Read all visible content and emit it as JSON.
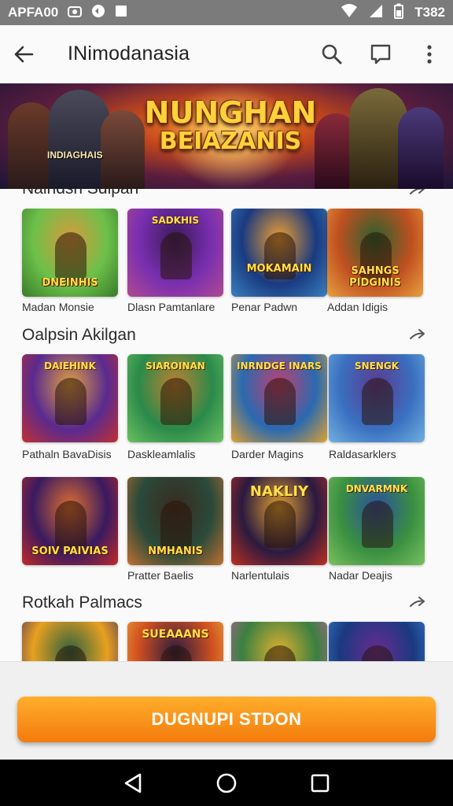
{
  "status_bar": {
    "left_text": "APFA00",
    "time": "T382"
  },
  "app_bar": {
    "title": "INimodanasia"
  },
  "hero": {
    "title_line1": "NUNGHAN",
    "title_line2": "BEIAZANIS",
    "subtitle": "INDIAGHAIS"
  },
  "sections": [
    {
      "title": "Nalndsn Sdipan",
      "items": [
        {
          "caption": "Madan Monsie",
          "art": "DNEINHIS",
          "colors": [
            "#6cc04a",
            "#3a7a2a",
            "#d89a3c"
          ]
        },
        {
          "caption": "Dlasn Pamtanlare",
          "art": "SADKHIS",
          "colors": [
            "#7a2fb0",
            "#b04a90",
            "#3a1a5a"
          ]
        },
        {
          "caption": "Penar Padwn",
          "art": "MOKAMAIN",
          "colors": [
            "#1a3a80",
            "#3a80c0",
            "#f0a030"
          ]
        },
        {
          "caption": "Addan Idigis",
          "art": "SAHNGS PIDGINIS",
          "colors": [
            "#c05020",
            "#e8a040",
            "#2a6030"
          ]
        }
      ]
    },
    {
      "title": "Oalpsin Akilgan",
      "items": [
        {
          "caption": "Pathaln BavaDisis",
          "art": "DAIEHINK",
          "colors": [
            "#5a2a90",
            "#c03030",
            "#e0a040"
          ]
        },
        {
          "caption": "Daskleamlalis",
          "art": "SIAROINAN",
          "colors": [
            "#2a8a4a",
            "#6cc060",
            "#c08030"
          ]
        },
        {
          "caption": "Darder Magins",
          "art": "INRNDGE INARS",
          "colors": [
            "#2a6ab0",
            "#e0a030",
            "#c04070"
          ]
        },
        {
          "caption": "Raldasarklers",
          "art": "SNENGK",
          "colors": [
            "#3a70c0",
            "#70b0e0",
            "#5a3a90"
          ]
        }
      ]
    },
    {
      "title": "",
      "items": [
        {
          "caption": "",
          "art": "SOIV PAIVIAS",
          "colors": [
            "#3a1a60",
            "#c02a2a",
            "#e07030"
          ]
        },
        {
          "caption": "Pratter Baelis",
          "art": "NMHANIS",
          "colors": [
            "#2a4a3a",
            "#c07030",
            "#3a2a20"
          ]
        },
        {
          "caption": "Narlentulais",
          "art": "NAKLIY",
          "colors": [
            "#2a1a40",
            "#c03020",
            "#e0a030"
          ]
        },
        {
          "caption": "Nadar Deajis",
          "art": "DNVARMNK",
          "colors": [
            "#3a9040",
            "#7ac060",
            "#2a50a0"
          ]
        }
      ]
    },
    {
      "title": "Rotkah Palmacs",
      "items": [
        {
          "caption": "",
          "art": "",
          "colors": [
            "#e8a020",
            "#3a2a60",
            "#2a6040"
          ]
        },
        {
          "caption": "",
          "art": "SUEAAANS",
          "colors": [
            "#d05020",
            "#f0b040",
            "#2a1a40"
          ]
        },
        {
          "caption": "",
          "art": "",
          "colors": [
            "#3a8040",
            "#c060a0",
            "#e0b030"
          ]
        },
        {
          "caption": "",
          "art": "",
          "colors": [
            "#1a3a80",
            "#3a80d0",
            "#6a2a90"
          ]
        }
      ]
    }
  ],
  "cta": {
    "label": "DUGNUPI STDON"
  },
  "colors": {
    "accent": "#f37b0c",
    "status_bar": "#7b7b7b",
    "nav_bar": "#000000"
  }
}
